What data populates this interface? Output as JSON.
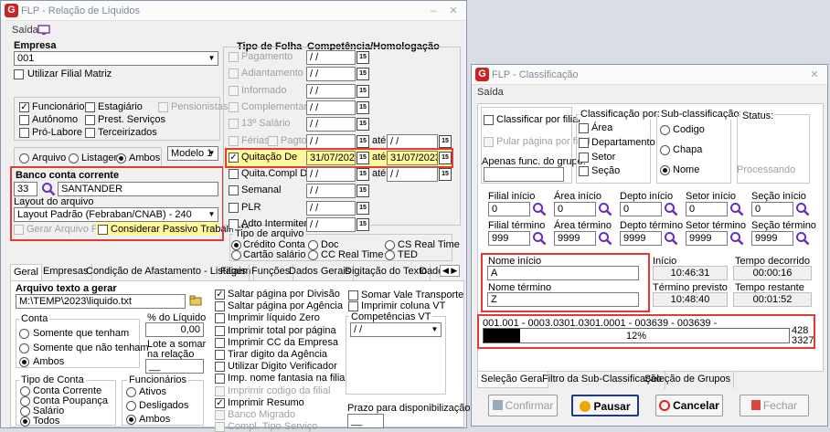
{
  "main_window": {
    "title": "FLP - Relação de Líquidos",
    "menu": {
      "saida": "Saída"
    },
    "empresa": {
      "label": "Empresa",
      "value": "001",
      "utilizar_filial_matriz": "Utilizar Filial Matriz"
    },
    "tipos": {
      "funcionario": "Funcionário",
      "estagiario": "Estagiário",
      "pensionistas": "Pensionistas",
      "autonomo": "Autônomo",
      "prest_servicos": "Prest. Serviços",
      "pro_labore": "Pró-Labore",
      "terceirizados": "Terceirizados"
    },
    "saida_modo": {
      "arquivo": "Arquivo",
      "listagem": "Listagem",
      "ambos": "Ambos",
      "modelo": "Modelo 1"
    },
    "banco": {
      "label": "Banco conta corrente",
      "code": "33",
      "name": "SANTANDER",
      "layout_label": "Layout do arquivo",
      "layout_value": "Layout Padrão (Febraban/CNAB) - 240",
      "gerar_pix": "Gerar Arquivo PIX",
      "considerar_passivo": "Considerar Passivo Trabalhista"
    },
    "tipo_folha": {
      "label": "Tipo de Folha",
      "comp_label": "Competência/Homologação",
      "ate": "até",
      "empty_date": "/ /",
      "items": [
        {
          "label": "Pagamento",
          "value": "/ /"
        },
        {
          "label": "Adiantamento",
          "value": "/ /"
        },
        {
          "label": "Informado",
          "value": "/ /"
        },
        {
          "label": "Complementar",
          "value": "/ /"
        },
        {
          "label": "13º Salário",
          "value": "/ /"
        },
        {
          "label": "Férias",
          "label2": "Pagto",
          "value": "/ /",
          "end": "/ /"
        },
        {
          "label": "Quitação De",
          "value": "31/07/2023",
          "end": "31/07/2023"
        },
        {
          "label": "Quita.Compl De",
          "value": "/ /",
          "end": "/ /"
        },
        {
          "label": "Semanal",
          "value": "/ /"
        },
        {
          "label": "PLR",
          "value": "/ /"
        },
        {
          "label": "Adto Intermitente",
          "value": "/ /"
        }
      ]
    },
    "tipo_arquivo": {
      "label": "Tipo de arquivo",
      "credito_conta": "Crédito Conta",
      "doc": "Doc",
      "cs_real_time": "CS Real Time",
      "cartao_salario": "Cartão salário",
      "cc_real_time": "CC Real Time",
      "ted": "TED"
    },
    "tabs": [
      "Geral",
      "Empresas",
      "Condição de Afastamento - Listagem",
      "Filiais",
      "Funções",
      "Dados Gerais",
      "Digitação do Texto",
      "Dado"
    ],
    "geral": {
      "arquivo_label": "Arquivo texto a gerar",
      "arquivo_value": "M:\\TEMP\\2023\\liquido.txt",
      "conta_label": "Conta",
      "somente_que_tenham": "Somente que tenham",
      "somente_que_nao_tenham": "Somente que não tenham",
      "ambos": "Ambos",
      "pct_liquido_label": "% do Líquido",
      "pct_liquido_value": "0,00",
      "lote_label": "Lote a somar",
      "lote_label2": "na relação",
      "tipo_conta_label": "Tipo de Conta",
      "conta_corrente": "Conta Corrente",
      "conta_poupanca": "Conta Poupança",
      "salario": "Salário",
      "todos": "Todos",
      "funcionarios_label": "Funcionários",
      "ativos": "Ativos",
      "desligados": "Desligados",
      "func_ambos": "Ambos",
      "options": [
        {
          "label": "Saltar página por Divisão",
          "checked": true,
          "disabled": false
        },
        {
          "label": "Saltar página por Agência",
          "checked": false,
          "disabled": false
        },
        {
          "label": "Imprimir líquido Zero",
          "checked": false,
          "disabled": false
        },
        {
          "label": "Imprimir total por página",
          "checked": false,
          "disabled": false
        },
        {
          "label": "Imprimir CC da Empresa",
          "checked": false,
          "disabled": false
        },
        {
          "label": "Tirar digito da Agência",
          "checked": false,
          "disabled": false
        },
        {
          "label": "Utilizar Digito Verificador",
          "checked": false,
          "disabled": false
        },
        {
          "label": "Imp. nome fantasia na filial",
          "checked": false,
          "disabled": false
        },
        {
          "label": "Imprimir codigo da filial",
          "checked": false,
          "disabled": true
        },
        {
          "label": "Imprimir Resumo",
          "checked": true,
          "disabled": false
        },
        {
          "label": "Banco Migrado",
          "checked": false,
          "disabled": true
        },
        {
          "label": "Compl. Tipo Serviço",
          "checked": false,
          "disabled": true
        }
      ],
      "somar_vale_transporte": "Somar Vale Transporte",
      "imprimir_coluna_vt": "Imprimir coluna VT",
      "competencias_vt_label": "Competências VT",
      "competencias_vt_value": "/ /",
      "prazo_label": "Prazo para disponibilização",
      "prazo_value": "__"
    }
  },
  "dialog": {
    "title": "FLP - Classificação",
    "menu": {
      "saida": "Saída"
    },
    "classificar_por_filial": "Classificar por filial",
    "pular_pagina": "Pular página por filial",
    "apenas_func_label": "Apenas func. do grupo:",
    "classificacao_label": "Classificação por:",
    "area": "Área",
    "departamento": "Departamento",
    "setor": "Setor",
    "secao": "Seção",
    "subclass_label": "Sub-classificação:",
    "codigo": "Codigo",
    "chapa": "Chapa",
    "nome": "Nome",
    "status_label": "Status:",
    "status_value": "Processando",
    "ranges": [
      {
        "ini_label": "Filial início",
        "ini_value": "0",
        "fim_label": "Filial término",
        "fim_value": "999"
      },
      {
        "ini_label": "Área início",
        "ini_value": "0",
        "fim_label": "Área término",
        "fim_value": "9999"
      },
      {
        "ini_label": "Depto início",
        "ini_value": "0",
        "fim_label": "Depto término",
        "fim_value": "9999"
      },
      {
        "ini_label": "Setor início",
        "ini_value": "0",
        "fim_label": "Setor término",
        "fim_value": "9999"
      },
      {
        "ini_label": "Seção início",
        "ini_value": "0",
        "fim_label": "Seção término",
        "fim_value": "9999"
      }
    ],
    "nome_inicio_label": "Nome início",
    "nome_inicio_value": "A",
    "nome_termino_label": "Nome término",
    "nome_termino_value": "Z",
    "inicio_label": "Início",
    "inicio_value": "10:46:31",
    "tempo_decorrido_label": "Tempo decorrido",
    "tempo_decorrido_value": "00:00:16",
    "termino_label": "Término previsto",
    "termino_value": "10:48:40",
    "tempo_restante_label": "Tempo restante",
    "tempo_restante_value": "00:01:52",
    "progress_text": "001.001 - 0003.0301.0301.0001 - 003639 - 003639 -",
    "progress_pct": 12,
    "progress_label": "12%",
    "count_current": "428",
    "count_total": "3327",
    "tabs": [
      "Seleção Geral",
      "Filtro da Sub-Classificação",
      "Seleção de Grupos"
    ],
    "buttons": {
      "confirmar": "Confirmar",
      "pausar": "Pausar",
      "cancelar": "Cancelar",
      "fechar": "Fechar"
    }
  }
}
